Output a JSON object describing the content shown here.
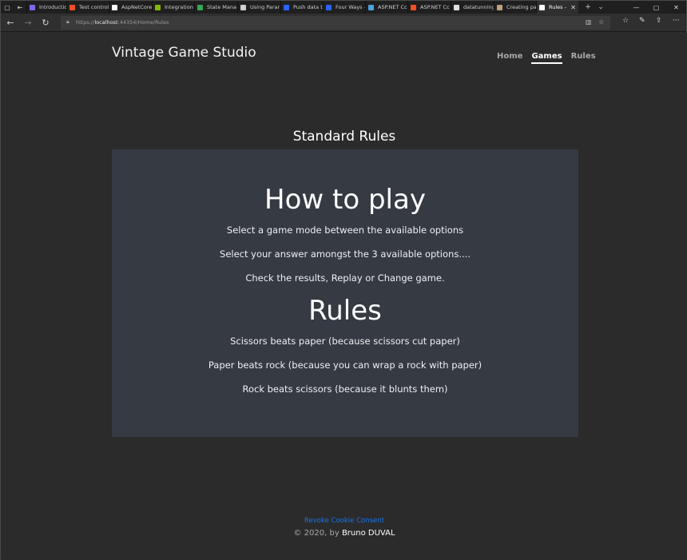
{
  "browser": {
    "tabs": [
      {
        "label": "Introductio",
        "color": "#7b68ee"
      },
      {
        "label": "Test control",
        "color": "#f25022"
      },
      {
        "label": "AspNetCore",
        "color": "#ffffff"
      },
      {
        "label": "Integration",
        "color": "#7fba00"
      },
      {
        "label": "State Mana",
        "color": "#34a853"
      },
      {
        "label": "Using Parar",
        "color": "#d0d0d0"
      },
      {
        "label": "Push data t",
        "color": "#2962ff"
      },
      {
        "label": "Four Ways -",
        "color": "#2962ff"
      },
      {
        "label": "ASP.NET Cc",
        "color": "#4aa3df"
      },
      {
        "label": "ASP.NET Cc",
        "color": "#f25022"
      },
      {
        "label": "datatunning",
        "color": "#e0e0e0"
      },
      {
        "label": "Creating pa",
        "color": "#c0a080"
      },
      {
        "label": "Rules -",
        "color": "#ffffff",
        "active": true
      }
    ],
    "url_prefix": "https://",
    "url_host": "localhost",
    "url_path": ":44354/Home/Rules"
  },
  "site": {
    "brand": "Vintage Game Studio",
    "nav": {
      "home": "Home",
      "games": "Games",
      "rules": "Rules"
    },
    "section_title": "Standard Rules"
  },
  "content": {
    "how_title": "How to play",
    "how_lines": [
      "Select a game mode between the available options",
      "Select your answer amongst the 3 available options....",
      "Check the results, Replay or Change game."
    ],
    "rules_title": "Rules",
    "rules_lines": [
      "Scissors beats paper (because scissors cut paper)",
      "Paper beats rock (because you can wrap a rock with paper)",
      "Rock beats scissors (because it blunts them)"
    ]
  },
  "footer": {
    "revoke": "Revoke Cookie Consent",
    "copy_prefix": "© 2020, by",
    "author": "Bruno DUVAL"
  }
}
